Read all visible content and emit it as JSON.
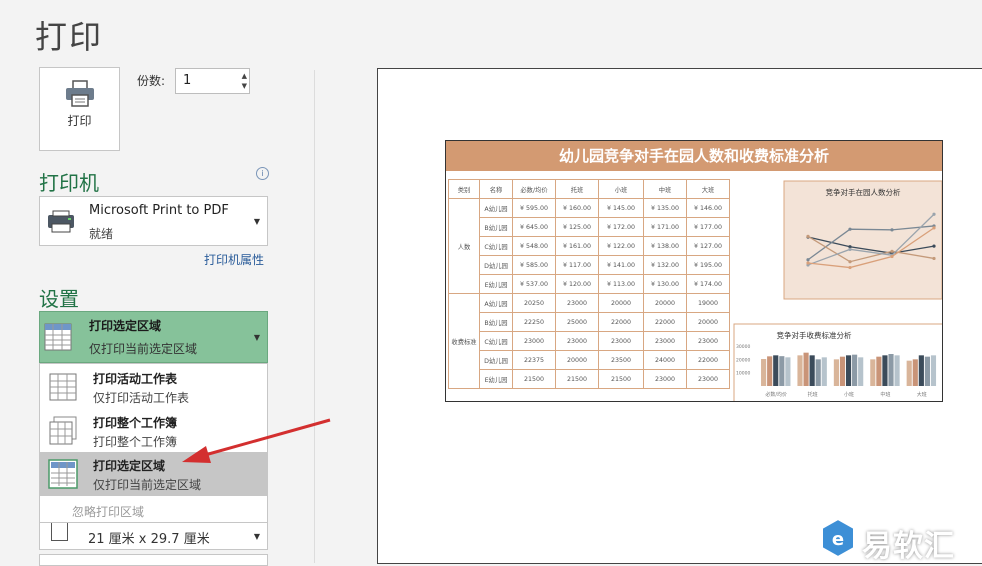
{
  "page": {
    "title": "打印"
  },
  "print_button": {
    "label": "打印"
  },
  "copies": {
    "label": "份数:",
    "value": "1"
  },
  "printer": {
    "section_title": "打印机",
    "name": "Microsoft Print to PDF",
    "status": "就绪",
    "properties_link": "打印机属性",
    "info_icon": "info-icon"
  },
  "settings": {
    "section_title": "设置",
    "selected": {
      "title": "打印选定区域",
      "subtitle": "仅打印当前选定区域"
    },
    "options": [
      {
        "title": "打印活动工作表",
        "subtitle": "仅打印活动工作表"
      },
      {
        "title": "打印整个工作簿",
        "subtitle": "打印整个工作簿"
      },
      {
        "title": "打印选定区域",
        "subtitle": "仅打印当前选定区域"
      }
    ],
    "ignore_print_area": "忽略打印区域",
    "paper_size": "21 厘米 x 29.7 厘米",
    "next_item": "..."
  },
  "preview": {
    "sheet_title": "幼儿园竞争对手在园人数和收费标准分析",
    "table_headers": [
      "类别",
      "名称",
      "必数/均价",
      "托班",
      "小班",
      "中班",
      "大班"
    ],
    "group1_label": "人数",
    "group2_label": "收费标准",
    "rows_people": [
      [
        "A幼儿园",
        "¥ 595.00",
        "¥ 160.00",
        "¥ 145.00",
        "¥ 135.00",
        "¥ 146.00"
      ],
      [
        "B幼儿园",
        "¥ 645.00",
        "¥ 125.00",
        "¥ 172.00",
        "¥ 171.00",
        "¥ 177.00"
      ],
      [
        "C幼儿园",
        "¥ 548.00",
        "¥ 161.00",
        "¥ 122.00",
        "¥ 138.00",
        "¥ 127.00"
      ],
      [
        "D幼儿园",
        "¥ 585.00",
        "¥ 117.00",
        "¥ 141.00",
        "¥ 132.00",
        "¥ 195.00"
      ],
      [
        "E幼儿园",
        "¥ 537.00",
        "¥ 120.00",
        "¥ 113.00",
        "¥ 130.00",
        "¥ 174.00"
      ]
    ],
    "rows_fees": [
      [
        "A幼儿园",
        "20250",
        "23000",
        "20000",
        "20000",
        "19000"
      ],
      [
        "B幼儿园",
        "22250",
        "25000",
        "22000",
        "22000",
        "20000"
      ],
      [
        "C幼儿园",
        "23000",
        "23000",
        "23000",
        "23000",
        "23000"
      ],
      [
        "D幼儿园",
        "22375",
        "20000",
        "23500",
        "24000",
        "22000"
      ],
      [
        "E幼儿园",
        "21500",
        "21500",
        "21500",
        "23000",
        "23000"
      ]
    ],
    "line_chart_title": "竞争对手在园人数分析",
    "bar_chart_title": "竞争对手收费标准分析",
    "bar_categories": [
      "必数/均价",
      "托班",
      "小班",
      "中班",
      "大班"
    ],
    "bar_ticks": [
      "30000",
      "20000",
      "10000"
    ]
  },
  "chart_data": [
    {
      "type": "line",
      "title": "竞争对手在园人数分析",
      "series": [
        {
          "values": [
            160,
            145,
            135,
            146
          ]
        },
        {
          "values": [
            125,
            172,
            171,
            177
          ]
        },
        {
          "values": [
            161,
            122,
            138,
            127
          ]
        },
        {
          "values": [
            117,
            141,
            132,
            195
          ]
        },
        {
          "values": [
            120,
            113,
            130,
            174
          ]
        }
      ]
    },
    {
      "type": "bar",
      "title": "竞争对手收费标准分析",
      "categories": [
        "必数/均价",
        "托班",
        "小班",
        "中班",
        "大班"
      ],
      "series": [
        {
          "values": [
            20250,
            23000,
            20000,
            20000,
            19000
          ]
        },
        {
          "values": [
            22250,
            25000,
            22000,
            22000,
            20000
          ]
        },
        {
          "values": [
            23000,
            23000,
            23000,
            23000,
            23000
          ]
        },
        {
          "values": [
            22375,
            20000,
            23500,
            24000,
            22000
          ]
        },
        {
          "values": [
            21500,
            21500,
            21500,
            23000,
            23000
          ]
        }
      ],
      "ylim": [
        0,
        30000
      ]
    }
  ],
  "watermark": {
    "text": "易软汇"
  },
  "colors": {
    "accent": "#217346",
    "selected_bg": "#86c29a",
    "banner": "#d39a72",
    "annotation_arrow": "#d32f2f"
  }
}
